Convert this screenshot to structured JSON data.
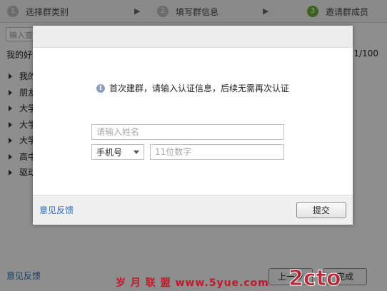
{
  "wizard": {
    "steps": [
      {
        "num": "1",
        "label": "选择群类别"
      },
      {
        "num": "2",
        "label": "填写群信息"
      },
      {
        "num": "3",
        "label": "邀请群成员"
      }
    ],
    "step_arrow": "▶",
    "search_placeholder": "输入查找关键字",
    "friends_title": "我的好友",
    "count": "1/100",
    "groups": [
      "我的",
      "朋友",
      "大学",
      "大学",
      "大学",
      "高中",
      "驱动"
    ],
    "feedback": "意见反馈",
    "prev_label": "上一步",
    "next_label": "完成"
  },
  "dialog": {
    "notice": "首次建群，请输入认证信息，后续无需再次认证",
    "info_icon": "info-icon",
    "name_placeholder": "请输入姓名",
    "contact_type": "手机号",
    "digits_placeholder": "11位数字",
    "feedback": "意见反馈",
    "submit_label": "提交"
  },
  "watermark": {
    "text": "岁 月 联 盟   www.5yue.com",
    "logo_text": "2cto"
  },
  "colors": {
    "link": "#2a6cb8",
    "active_step": "#6aa83a",
    "watermark_red": "#c0182b"
  }
}
